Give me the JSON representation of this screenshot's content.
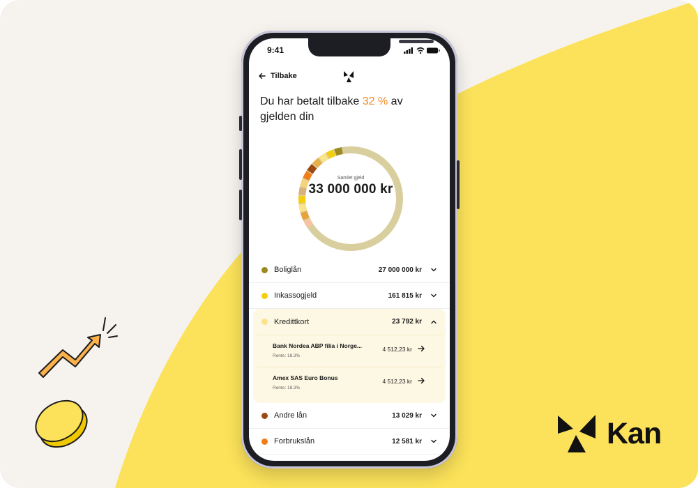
{
  "colors": {
    "background": "#f6f3ef",
    "yellow": "#fbe25a",
    "accent_orange": "#f08a24",
    "expanded_bg": "#fdf8e3"
  },
  "status_bar": {
    "time": "9:41"
  },
  "nav": {
    "back_label": "Tilbake",
    "back_icon": "arrow-left-icon",
    "logo_icon": "kan-star-icon"
  },
  "headline": {
    "prefix": "Du har betalt tilbake ",
    "percent": "32 %",
    "suffix": " av gjelden din"
  },
  "donut": {
    "caption": "Samlet gjeld",
    "total": "33 000 000 kr",
    "paid_fraction": 0.32
  },
  "debts": [
    {
      "name": "Boliglån",
      "amount": "27 000 000 kr",
      "color": "#9c8a20",
      "expanded": false
    },
    {
      "name": "Inkassogjeld",
      "amount": "161 815 kr",
      "color": "#f3cf10",
      "expanded": false
    },
    {
      "name": "Kredittkort",
      "amount": "23 792 kr",
      "color": "#fbe38a",
      "expanded": true,
      "accounts": [
        {
          "bank": "Bank Nordea ABP filia i Norge...",
          "rate": "Rente: 18.3%",
          "amount": "4 512,23 kr"
        },
        {
          "bank": "Amex SAS Euro Bonus",
          "rate": "Rente: 18.3%",
          "amount": "4 512,23 kr"
        }
      ]
    },
    {
      "name": "Andre lån",
      "amount": "13 029 kr",
      "color": "#9a4a12",
      "expanded": false
    },
    {
      "name": "Forbrukslån",
      "amount": "12 581 kr",
      "color": "#f07c1a",
      "expanded": false
    }
  ],
  "brand": {
    "name": "Kan"
  },
  "decor": {
    "icons": [
      "trend-up-arrow-icon",
      "coin-icon"
    ]
  }
}
